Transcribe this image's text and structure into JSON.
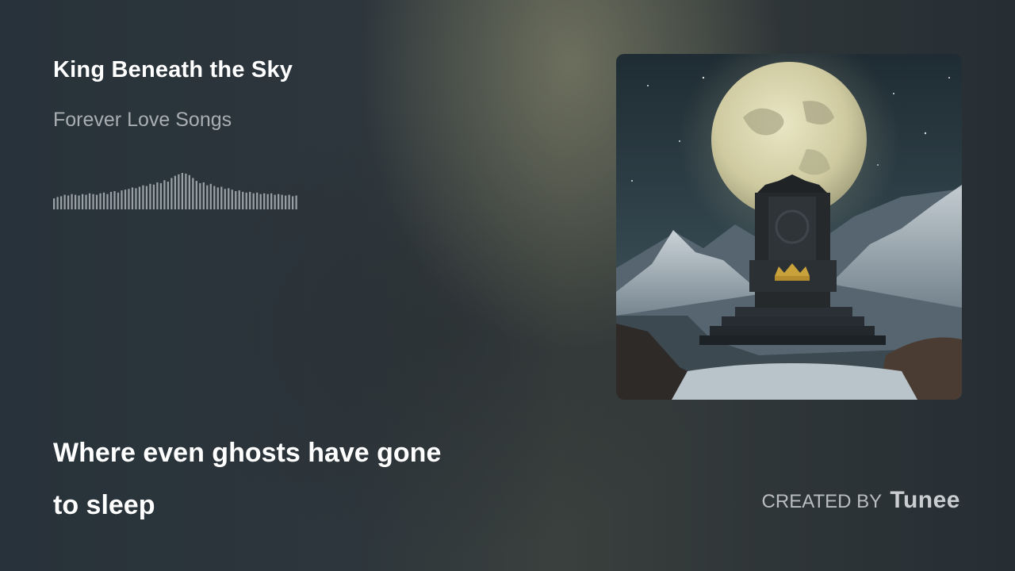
{
  "track": {
    "title": "King Beneath the Sky",
    "album": "Forever Love Songs"
  },
  "waveform": {
    "levels": [
      0.3,
      0.34,
      0.36,
      0.4,
      0.38,
      0.42,
      0.4,
      0.38,
      0.42,
      0.4,
      0.44,
      0.42,
      0.4,
      0.44,
      0.46,
      0.42,
      0.48,
      0.5,
      0.46,
      0.52,
      0.54,
      0.56,
      0.6,
      0.58,
      0.62,
      0.66,
      0.64,
      0.7,
      0.68,
      0.74,
      0.72,
      0.8,
      0.76,
      0.86,
      0.92,
      0.96,
      1.0,
      0.98,
      0.94,
      0.86,
      0.78,
      0.72,
      0.74,
      0.66,
      0.7,
      0.64,
      0.6,
      0.62,
      0.56,
      0.58,
      0.54,
      0.5,
      0.52,
      0.48,
      0.46,
      0.48,
      0.44,
      0.46,
      0.42,
      0.44,
      0.42,
      0.44,
      0.4,
      0.42,
      0.4,
      0.38,
      0.4,
      0.36,
      0.38
    ],
    "color": "#9aa1a6"
  },
  "cover": {
    "alt_icon": "album-cover-art"
  },
  "lyrics": {
    "line1": "Where even ghosts have gone",
    "line2": "to sleep"
  },
  "credit": {
    "prefix": "CREATED BY",
    "brand": "Tunee"
  }
}
